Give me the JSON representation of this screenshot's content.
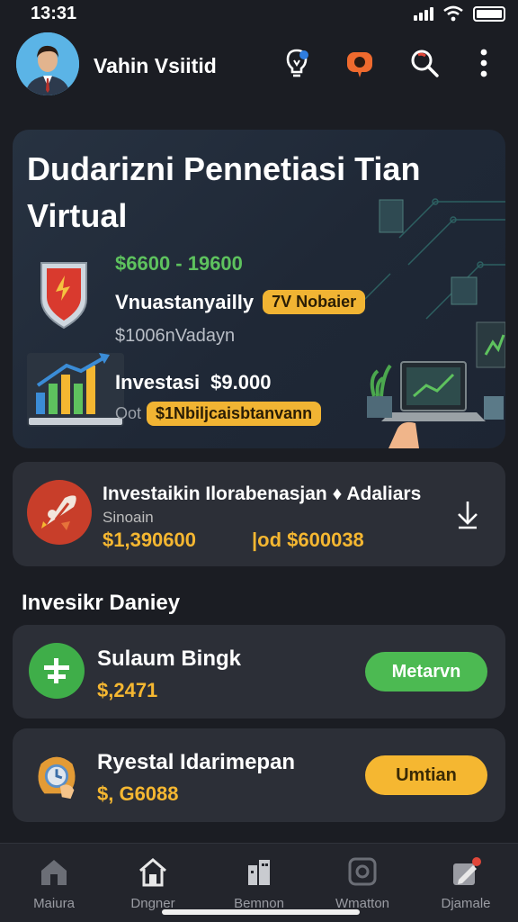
{
  "status_bar": {
    "time": "13:31"
  },
  "header": {
    "username": "Vahin Vsiitid"
  },
  "hero": {
    "title": "Dudarizni Pennetiasi Tian Virtual",
    "range": "$6600 - 19600",
    "row1_label": "Vnuastanyailly",
    "row1_badge": "7V Nobaier",
    "row1_sub": "$1006nVadayn",
    "row2_label": "Investasi",
    "row2_value": "$9.000",
    "row2_prefix": "Oot",
    "row2_badge": "$1Nbiljcaisbtanvann"
  },
  "summary": {
    "title": "Investaikin Ilorabenasjan ♦ Adaliars",
    "subtitle": "Sinoain",
    "amount1": "$1,390600",
    "amount2": "|od $600038"
  },
  "section": {
    "title": "Invesikr Daniey"
  },
  "items": [
    {
      "name": "Sulaum Bingk",
      "value": "$,2471",
      "button": "Metarvn",
      "value_color": "#f5b731",
      "button_color": "#4cba52",
      "button_text_color": "#ffffff",
      "icon_color": "#3fae49"
    },
    {
      "name": "Ryestal Idarimepan",
      "value": "$, G6088",
      "button": "Umtian",
      "value_color": "#f5b731",
      "button_color": "#f5b731",
      "button_text_color": "#3a2a05",
      "icon_color": "#e39b35"
    }
  ],
  "bottom_nav": [
    {
      "label": "Maiura",
      "icon": "home-icon"
    },
    {
      "label": "Dngner",
      "icon": "home-icon"
    },
    {
      "label": "Bemnon",
      "icon": "building-icon"
    },
    {
      "label": "Wmatton",
      "icon": "square-icon"
    },
    {
      "label": "Djamale",
      "icon": "edit-icon"
    }
  ],
  "colors": {
    "background": "#1b1d23",
    "card": "#2c2f37",
    "accent_gold": "#f5b731",
    "accent_green": "#4cba52",
    "range_green": "#5ec25e"
  }
}
